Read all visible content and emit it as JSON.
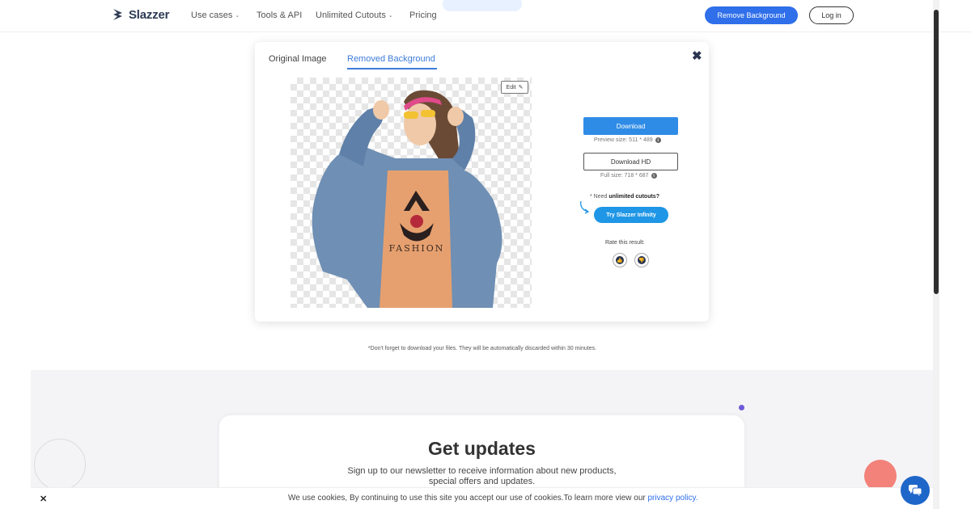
{
  "header": {
    "logo_text": "Slazzer",
    "nav": [
      {
        "label": "Use cases",
        "has_dropdown": true
      },
      {
        "label": "Tools & API",
        "has_dropdown": false
      },
      {
        "label": "Unlimited Cutouts",
        "has_dropdown": true
      },
      {
        "label": "Pricing",
        "has_dropdown": false
      }
    ],
    "remove_bg_label": "Remove Background",
    "login_label": "Log in"
  },
  "modal": {
    "tabs": [
      {
        "label": "Original Image",
        "active": false
      },
      {
        "label": "Removed Background",
        "active": true
      }
    ],
    "close_icon": "close-icon",
    "edit_label": "Edit",
    "image_shirt_text": "FASHION",
    "download_label": "Download",
    "preview_size": "Preview size: 511 * 489",
    "download_hd_label": "Download HD",
    "full_size": "Full size: 718 * 687",
    "need_prefix": "* Need",
    "need_bold": "unlimited cutouts?",
    "try_label": "Try Slazzer Infinity",
    "rate_label": "Rate this result:"
  },
  "discard_note": "*Don't forget to download your files. They will be automatically discarded within 30 minutes.",
  "updates": {
    "title": "Get updates",
    "text_line1": "Sign up to our newsletter to receive information about new products,",
    "text_line2": "special offers and updates."
  },
  "cookie": {
    "text": "We use cookies, By continuing to use this site you accept our use of cookies.To learn more view our",
    "link": "privacy policy."
  },
  "colors": {
    "primary_blue": "#2f6fea",
    "download_blue": "#2f8ce6",
    "try_blue": "#1f96e6",
    "tab_active": "#3d7bd9",
    "accent_coral": "#f2827a",
    "accent_purple": "#6e5ad8"
  }
}
